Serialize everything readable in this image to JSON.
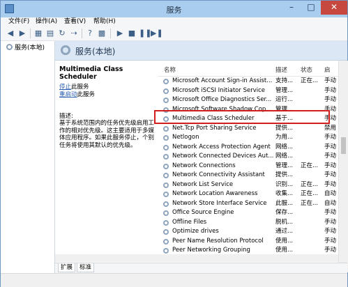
{
  "window": {
    "title": "服务"
  },
  "menu": [
    "文件(F)",
    "操作(A)",
    "查看(V)",
    "帮助(H)"
  ],
  "tree": {
    "root_label": "服务(本地)"
  },
  "content": {
    "header_title": "服务(本地)"
  },
  "description": {
    "service_name": "Multimedia Class Scheduler",
    "stop_link": "停止",
    "stop_suffix": "此服务",
    "restart_link": "重启动",
    "restart_suffix": "此服务",
    "desc_label": "描述:",
    "desc_text": "基于系统范围内的任务优先级启用工作的相对优先级。这主要适用于多媒体应用程序。如果此服务停止，个别任务将使用其默认的优先级。"
  },
  "list": {
    "columns": [
      "名称",
      "描述",
      "状态",
      "启"
    ],
    "rows": [
      {
        "name": "Microsoft Account Sign-in Assist...",
        "desc": "支持...",
        "status": "正在...",
        "startup": "手动"
      },
      {
        "name": "Microsoft iSCSI Initiator Service",
        "desc": "管理...",
        "status": "",
        "startup": "手动"
      },
      {
        "name": "Microsoft Office Diagnostics Ser...",
        "desc": "运行...",
        "status": "",
        "startup": "手动"
      },
      {
        "name": "Microsoft Software Shadow Cop...",
        "desc": "管理...",
        "status": "",
        "startup": "手动"
      },
      {
        "name": "Multimedia Class Scheduler",
        "desc": "基于...",
        "status": "",
        "startup": "手动"
      },
      {
        "name": "Net.Tcp Port Sharing Service",
        "desc": "提供...",
        "status": "",
        "startup": "禁用"
      },
      {
        "name": "Netlogon",
        "desc": "为用...",
        "status": "",
        "startup": "手动"
      },
      {
        "name": "Network Access Protection Agent",
        "desc": "网络...",
        "status": "",
        "startup": "手动"
      },
      {
        "name": "Network Connected Devices Aut...",
        "desc": "网络...",
        "status": "",
        "startup": "手动"
      },
      {
        "name": "Network Connections",
        "desc": "管理...",
        "status": "正在...",
        "startup": "手动"
      },
      {
        "name": "Network Connectivity Assistant",
        "desc": "提供...",
        "status": "",
        "startup": "手动"
      },
      {
        "name": "Network List Service",
        "desc": "识别...",
        "status": "正在...",
        "startup": "手动"
      },
      {
        "name": "Network Location Awareness",
        "desc": "收集...",
        "status": "正在...",
        "startup": "自动"
      },
      {
        "name": "Network Store Interface Service",
        "desc": "此服...",
        "status": "正在...",
        "startup": "自动"
      },
      {
        "name": "Office Source Engine",
        "desc": "保存...",
        "status": "",
        "startup": "手动"
      },
      {
        "name": "Offline Files",
        "desc": "脱机...",
        "status": "",
        "startup": "手动"
      },
      {
        "name": "Optimize drives",
        "desc": "通过...",
        "status": "",
        "startup": "手动"
      },
      {
        "name": "Peer Name Resolution Protocol",
        "desc": "使用...",
        "status": "",
        "startup": "手动"
      },
      {
        "name": "Peer Networking Grouping",
        "desc": "使用...",
        "status": "",
        "startup": "手动"
      }
    ]
  },
  "tabs": [
    "扩展",
    "标准"
  ]
}
